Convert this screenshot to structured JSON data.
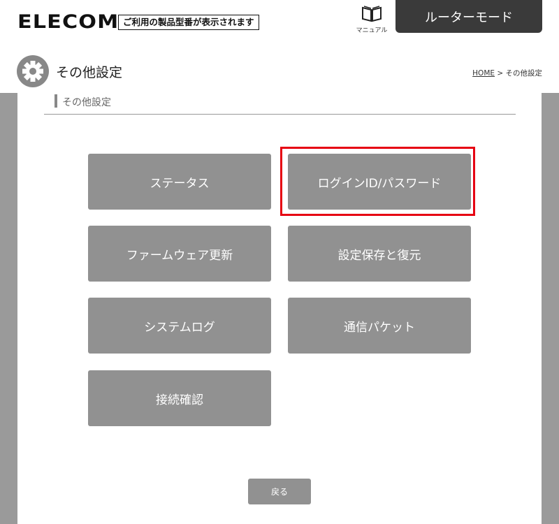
{
  "header": {
    "logo": "ELECOM",
    "model_note": "ご利用の製品型番が表示されます",
    "manual_label": "マニュアル",
    "mode_button": "ルーターモード"
  },
  "page": {
    "title": "その他設定",
    "breadcrumb_home": "HOME",
    "breadcrumb_sep": " > ",
    "breadcrumb_current": "その他設定"
  },
  "section": {
    "title": "その他設定"
  },
  "menu": {
    "status": "ステータス",
    "login": "ログインID/パスワード",
    "firmware": "ファームウェア更新",
    "backup": "設定保存と復元",
    "syslog": "システムログ",
    "packet": "通信パケット",
    "connection": "接続確認"
  },
  "back_label": "戻る",
  "colors": {
    "highlight": "#e60012",
    "button": "#919191",
    "mode_button": "#3a3a3a",
    "side_gray": "#9a9a9a"
  }
}
